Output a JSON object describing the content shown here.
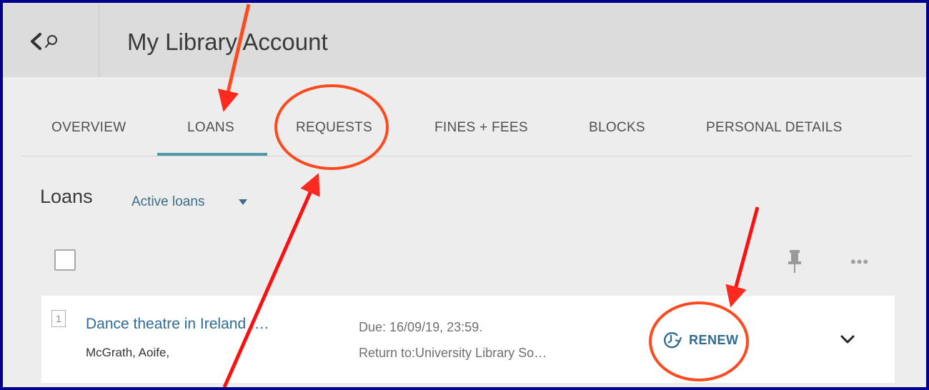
{
  "header": {
    "title": "My Library Account",
    "back_search_icon": "back-search-icon"
  },
  "tabs": [
    {
      "label": "OVERVIEW",
      "active": false
    },
    {
      "label": "LOANS",
      "active": true
    },
    {
      "label": "REQUESTS",
      "active": false
    },
    {
      "label": "FINES + FEES",
      "active": false
    },
    {
      "label": "BLOCKS",
      "active": false
    },
    {
      "label": "PERSONAL DETAILS",
      "active": false
    }
  ],
  "loans": {
    "title": "Loans",
    "filter_value": "Active loans",
    "toolbar_icons": [
      "pin-icon",
      "more-options-icon"
    ],
    "items": [
      {
        "index": "1",
        "title": "Dance theatre in Ireland :…",
        "author": "McGrath, Aoife,",
        "due": "Due: 16/09/19, 23:59.",
        "return_to": "Return to:University Library So…",
        "action_label": "RENEW",
        "action_icon": "renew-clock-icon"
      }
    ]
  },
  "colors": {
    "accent": "#4f9aa8",
    "link": "#2f6b94",
    "annotation": "#ff3b1f",
    "border": "#00008b"
  }
}
